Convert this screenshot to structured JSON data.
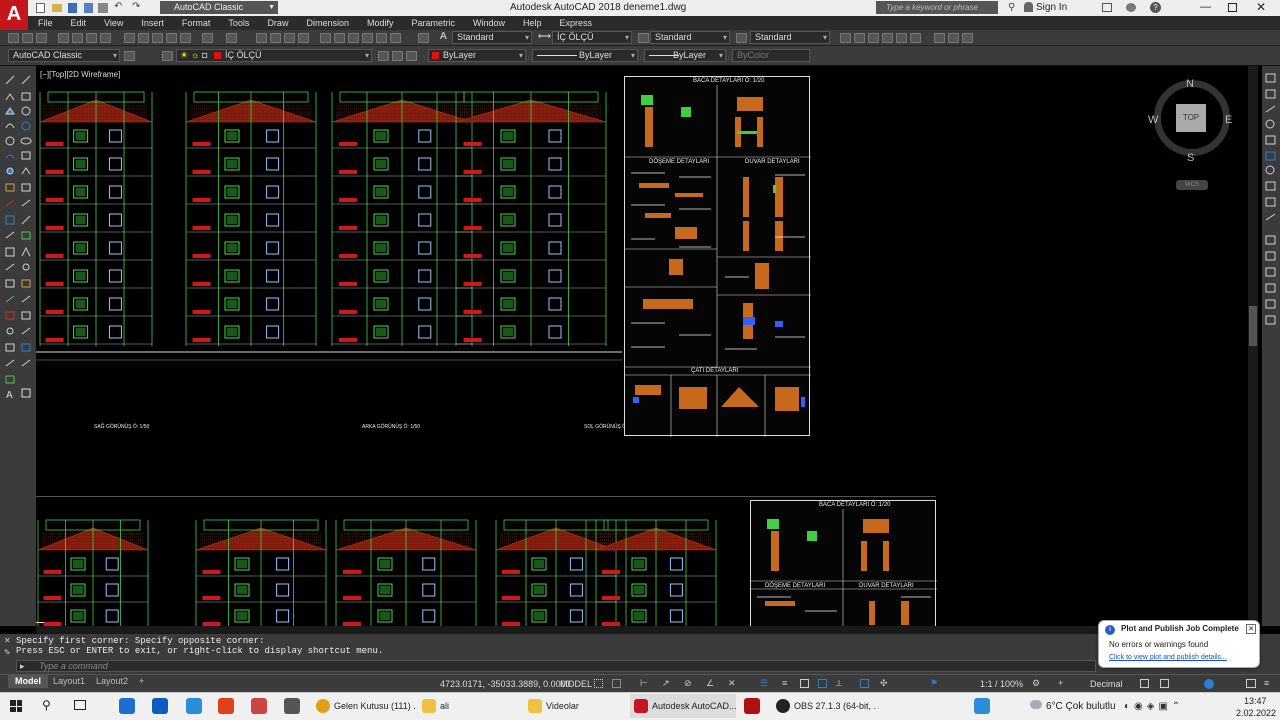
{
  "window": {
    "title": "Autodesk AutoCAD 2018   deneme1.dwg",
    "workspace": "AutoCAD Classic",
    "search_placeholder": "Type a keyword or phrase",
    "sign_in": "Sign In"
  },
  "app_logo": "A",
  "menu": [
    "File",
    "Edit",
    "View",
    "Insert",
    "Format",
    "Tools",
    "Draw",
    "Dimension",
    "Modify",
    "Parametric",
    "Window",
    "Help",
    "Express"
  ],
  "styles": {
    "text_style": "Standard",
    "dim_style": "İÇ ÖLÇÜ",
    "table_style": "Standard",
    "mleader_style": "Standard"
  },
  "layers": {
    "workspace": "AutoCAD Classic",
    "current_layer": "İÇ ÖLÇÜ",
    "color": "ByLayer",
    "linetype": "ByLayer",
    "lineweight": "ByLayer",
    "plotstyle": "ByColor"
  },
  "viewport": {
    "label": "[−][Top][2D Wireframe]",
    "compass": {
      "n": "N",
      "s": "S",
      "e": "E",
      "w": "W",
      "top": "TOP",
      "wcs": "WCS"
    }
  },
  "drawing": {
    "sheet1_title": "BACA DETAYLARI Ö: 1/20",
    "sheet1_sub1": "DÖŞEME DETAYLARI",
    "sheet1_sub2": "DUVAR DETAYLARI",
    "sheet1_roof": "ÇATI DETAYLARI",
    "view_left": "SAĞ GÖRÜNÜŞ Ö: 1/50",
    "view_mid": "ARKA GÖRÜNÜŞ Ö: 1/50",
    "view_right": "SOL GÖRÜNÜŞ Ö: 1/50",
    "sheet2_title": "BACA DETAYLARI Ö: 1/20",
    "sheet2_sub1": "DÖŞEME DETAYLARI",
    "sheet2_sub2": "DUVAR DETAYLARI"
  },
  "command": {
    "history_line1": "Specify first corner: Specify opposite corner:",
    "history_line2": "Press ESC or ENTER to exit, or right-click to display shortcut menu.",
    "prompt_placeholder": "Type a command"
  },
  "layout_tabs": [
    "Model",
    "Layout1",
    "Layout2"
  ],
  "status": {
    "coords": "4723.0171, -35033.3889, 0.0000",
    "space": "MODEL",
    "scale": "1:1 / 100%",
    "units": "Decimal"
  },
  "notification": {
    "title": "Plot and Publish Job Complete",
    "message": "No errors or warnings found",
    "link": "Click to view plot and publish details..."
  },
  "taskbar": {
    "items": [
      "Gelen Kutusu (111) ...",
      "ali",
      "Videolar",
      "Autodesk AutoCAD...",
      "OBS 27.1.3 (64-bit, ..."
    ],
    "weather": "6°C  Çok bulutlu",
    "time": "13:47",
    "date": "2.02.2022"
  }
}
